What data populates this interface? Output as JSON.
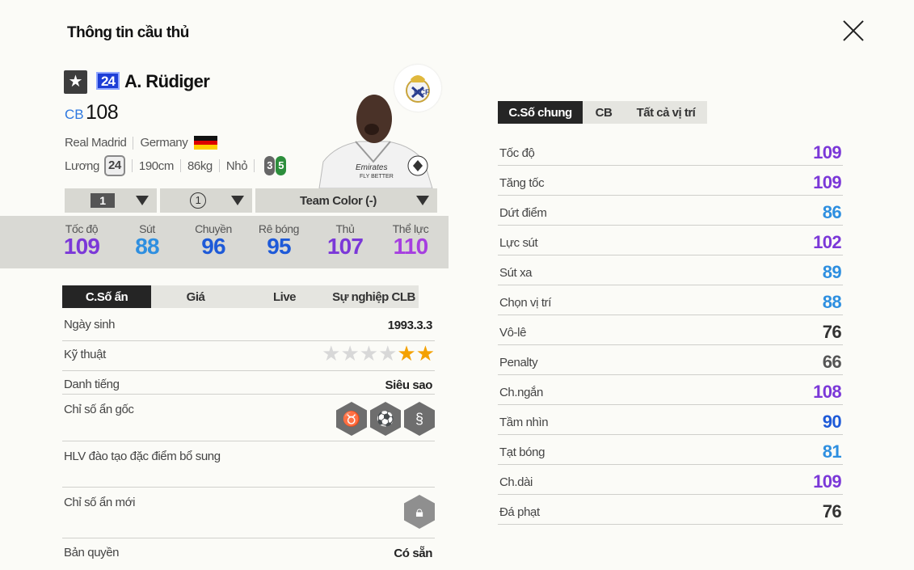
{
  "header": {
    "title": "Thông tin cầu thủ"
  },
  "player": {
    "season_badge": "24",
    "name": "A. Rüdiger",
    "position": "CB",
    "ovr": "108",
    "club": "Real Madrid",
    "nation": "Germany",
    "salary_label": "Lương",
    "salary": "24",
    "height": "190cm",
    "weight": "86kg",
    "body_type": "Nhỏ",
    "weak_foot_left": "3",
    "weak_foot_right": "5"
  },
  "selectors": {
    "level": "1",
    "team_color_level": "1",
    "team_color": "Team Color (-)"
  },
  "summary_stats": [
    {
      "label": "Tốc độ",
      "value": "109",
      "color": "#7b38d8"
    },
    {
      "label": "Sút",
      "value": "88",
      "color": "#2e8fe0"
    },
    {
      "label": "Chuyền",
      "value": "96",
      "color": "#1e5ad8"
    },
    {
      "label": "Rê bóng",
      "value": "95",
      "color": "#1e5ad8"
    },
    {
      "label": "Thủ",
      "value": "107",
      "color": "#7b38d8"
    },
    {
      "label": "Thể lực",
      "value": "110",
      "color": "#a63fe0"
    }
  ],
  "left_tabs": [
    "C.Số ẩn",
    "Giá",
    "Live",
    "Sự nghiệp CLB"
  ],
  "info": {
    "birth_label": "Ngày sinh",
    "birth_value": "1993.3.3",
    "skill_label": "Kỹ thuật",
    "skill_stars": 2,
    "skill_stars_max": 6,
    "fame_label": "Danh tiếng",
    "fame_value": "Siêu sao",
    "traits_label": "Chỉ số ẩn gốc",
    "coach_label": "HLV đào tạo đặc điểm bổ sung",
    "new_traits_label": "Chỉ số ẩn mới",
    "copyright_label": "Bản quyền",
    "copyright_value": "Có sẵn"
  },
  "right_tabs": [
    "C.Số chung",
    "CB",
    "Tất cả vị trí"
  ],
  "stats": [
    {
      "label": "Tốc độ",
      "value": "109",
      "color": "#7b38d8"
    },
    {
      "label": "Tăng tốc",
      "value": "109",
      "color": "#7b38d8"
    },
    {
      "label": "Dứt điểm",
      "value": "86",
      "color": "#2e8fe0"
    },
    {
      "label": "Lực sút",
      "value": "102",
      "color": "#7b38d8"
    },
    {
      "label": "Sút xa",
      "value": "89",
      "color": "#2e8fe0"
    },
    {
      "label": "Chọn vị trí",
      "value": "88",
      "color": "#2e8fe0"
    },
    {
      "label": "Vô-lê",
      "value": "76",
      "color": "#333333"
    },
    {
      "label": "Penalty",
      "value": "66",
      "color": "#555555"
    },
    {
      "label": "Ch.ngắn",
      "value": "108",
      "color": "#7b38d8"
    },
    {
      "label": "Tầm nhìn",
      "value": "90",
      "color": "#1e5ad8"
    },
    {
      "label": "Tạt bóng",
      "value": "81",
      "color": "#2e8fe0"
    },
    {
      "label": "Ch.dài",
      "value": "109",
      "color": "#7b38d8"
    },
    {
      "label": "Đá phạt",
      "value": "76",
      "color": "#333333"
    }
  ]
}
